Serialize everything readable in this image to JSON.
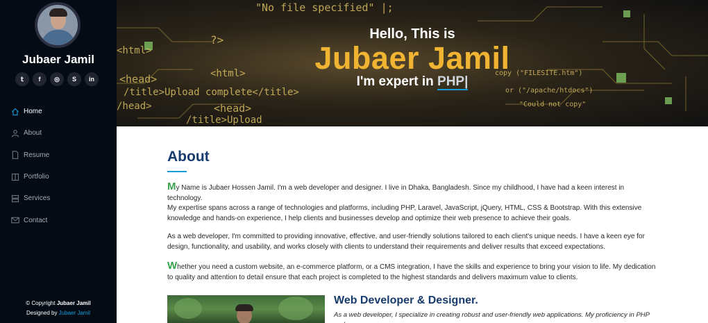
{
  "sidebar": {
    "name": "Jubaer Jamil",
    "socials": [
      {
        "icon": "twitter-icon",
        "glyph": "𝕥"
      },
      {
        "icon": "facebook-icon",
        "glyph": "f"
      },
      {
        "icon": "instagram-icon",
        "glyph": "◎"
      },
      {
        "icon": "skype-icon",
        "glyph": "S"
      },
      {
        "icon": "linkedin-icon",
        "glyph": "in"
      }
    ],
    "nav": [
      {
        "label": "Home",
        "icon": "home-icon",
        "active": true
      },
      {
        "label": "About",
        "icon": "user-icon",
        "active": false
      },
      {
        "label": "Resume",
        "icon": "file-icon",
        "active": false
      },
      {
        "label": "Portfolio",
        "icon": "book-icon",
        "active": false
      },
      {
        "label": "Services",
        "icon": "server-icon",
        "active": false
      },
      {
        "label": "Contact",
        "icon": "envelope-icon",
        "active": false
      }
    ],
    "footer": {
      "copyright_prefix": "© Copyright ",
      "copyright_name": "Jubaer Jamil",
      "designed_prefix": "Designed by ",
      "designed_name": "Jubaer Jamil"
    }
  },
  "hero": {
    "hello": "Hello, This is",
    "name": "Jubaer Jamil",
    "expert_prefix": "I'm expert in ",
    "expert_typed": "PHP|"
  },
  "about": {
    "title": "About",
    "p1_cap": "M",
    "p1": "y Name is Jubaer Hossen Jamil. I'm a web developer and designer. I live in Dhaka, Bangladesh. Since my childhood, I have had a keen interest in technology.",
    "p2": "My expertise spans across a range of technologies and platforms, including PHP, Laravel, JavaScript, jQuery, HTML, CSS & Bootstrap. With this extensive knowledge and hands-on experience, I help clients and businesses develop and optimize their web presence to achieve their goals.",
    "p3": "As a web developer, I'm committed to providing innovative, effective, and user-friendly solutions tailored to each client's unique needs. I have a keen eye for design, functionality, and usability, and works closely with clients to understand their requirements and deliver results that exceed expectations.",
    "p4_cap": "W",
    "p4": "hether you need a custom website, an e-commerce platform, or a CMS integration, I have the skills and experience to bring your vision to life. My dedication to quality and attention to detail ensure that each project is completed to the highest standards and delivers maximum value to clients.",
    "dev_title": "Web Developer & Designer.",
    "dev_text": "As a web developer, I specialize in creating robust and user-friendly web applications. My proficiency in PHP and"
  }
}
